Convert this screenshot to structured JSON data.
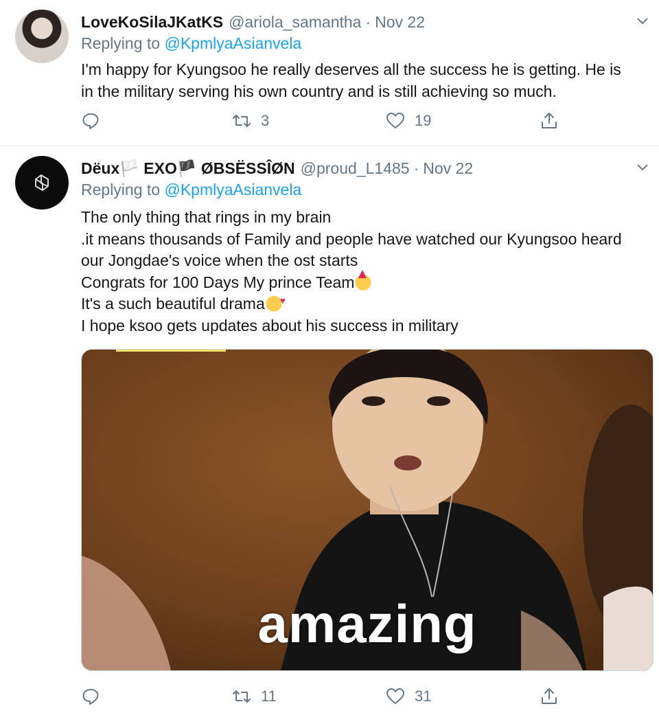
{
  "tweets": [
    {
      "display_name": "LoveKoSilaJKatKS",
      "handle": "@ariola_samantha",
      "separator": "·",
      "date": "Nov 22",
      "replying_prefix": "Replying to",
      "replying_to": "@KpmlyaAsianvela",
      "text_lines": [
        "I'm happy for Kyungsoo he really deserves all the success he is getting. He is",
        "in the military serving his own country and is still achieving so much."
      ],
      "retweets": "3",
      "likes": "19"
    },
    {
      "display_name": "Dëux🏳️ EXO🏴 ØBSËSSÎØN",
      "handle": "@proud_L1485",
      "separator": "·",
      "date": "Nov 22",
      "replying_prefix": "Replying to",
      "replying_to": "@KpmlyaAsianvela",
      "text_lines": [
        "The only thing that rings in my brain",
        ".it means thousands of Family and people have watched our Kyungsoo heard",
        "our Jongdae's voice when the ost starts",
        "Congrats for 100 Days My prince Team",
        "It's a such beautiful drama",
        "I hope ksoo gets updates about his success in military"
      ],
      "media_caption": "amazing",
      "retweets": "11",
      "likes": "31"
    }
  ],
  "icons": {
    "reply": "reply-icon",
    "retweet": "retweet-icon",
    "like": "heart-icon",
    "share": "share-icon",
    "menu": "chevron-down-icon"
  },
  "colors": {
    "link": "#1da1f2",
    "secondary_text": "#657786",
    "divider": "#e6ecf0"
  }
}
